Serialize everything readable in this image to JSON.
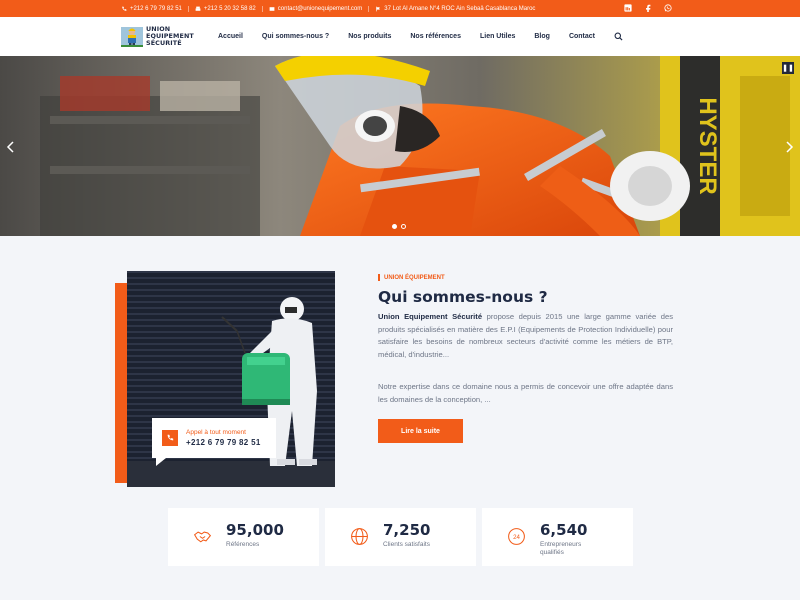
{
  "topbar": {
    "phone1": "+212 6 79 79 82 51",
    "phone2": "+212 5 20 32 58 82",
    "email": "contact@unionequipement.com",
    "address": "37 Lot Al Amane N°4 ROC Ain Sebaâ Casablanca Maroc",
    "social": [
      "linkedin-icon",
      "facebook-icon",
      "whatsapp-icon"
    ]
  },
  "logo": {
    "line1": "UNION",
    "line2": "EQUIPEMENT",
    "line3": "SÉCURITÉ"
  },
  "nav": {
    "items": [
      "Accueil",
      "Qui sommes-nous ?",
      "Nos produits",
      "Nos références",
      "Lien Utiles",
      "Blog",
      "Contact"
    ]
  },
  "hero": {
    "brand_text": "HYSTER",
    "slides": 2,
    "active_slide": 1
  },
  "about": {
    "subtitle": "UNION ÉQUIPEMENT",
    "title": "Qui sommes-nous ?",
    "para1_strong": "Union Equipement Sécurité",
    "para1_rest": " propose depuis 2015 une large gamme variée des produits spécialisés en matière des E.P.I (Equipements de Protection Individuelle) pour satisfaire les besoins de nombreux secteurs d'activité comme les métiers de BTP, médical, d'industrie...",
    "para2": "Notre expertise dans ce domaine nous a permis de concevoir une offre adaptée dans les domaines de la conception, ...",
    "button": "Lire la suite",
    "call_label": "Appel à tout moment",
    "call_number": "+212 6 79 79 82 51"
  },
  "stats": [
    {
      "value": "95,000",
      "label": "Références",
      "icon": "handshake-icon"
    },
    {
      "value": "7,250",
      "label": "Clients satisfaits",
      "icon": "globe-icon"
    },
    {
      "value": "6,540",
      "label": "Entrepreneurs qualifiés",
      "icon": "support-24-icon"
    }
  ],
  "colors": {
    "accent": "#f25c19",
    "dark": "#1f2a44",
    "bg": "#f3f5f9"
  }
}
